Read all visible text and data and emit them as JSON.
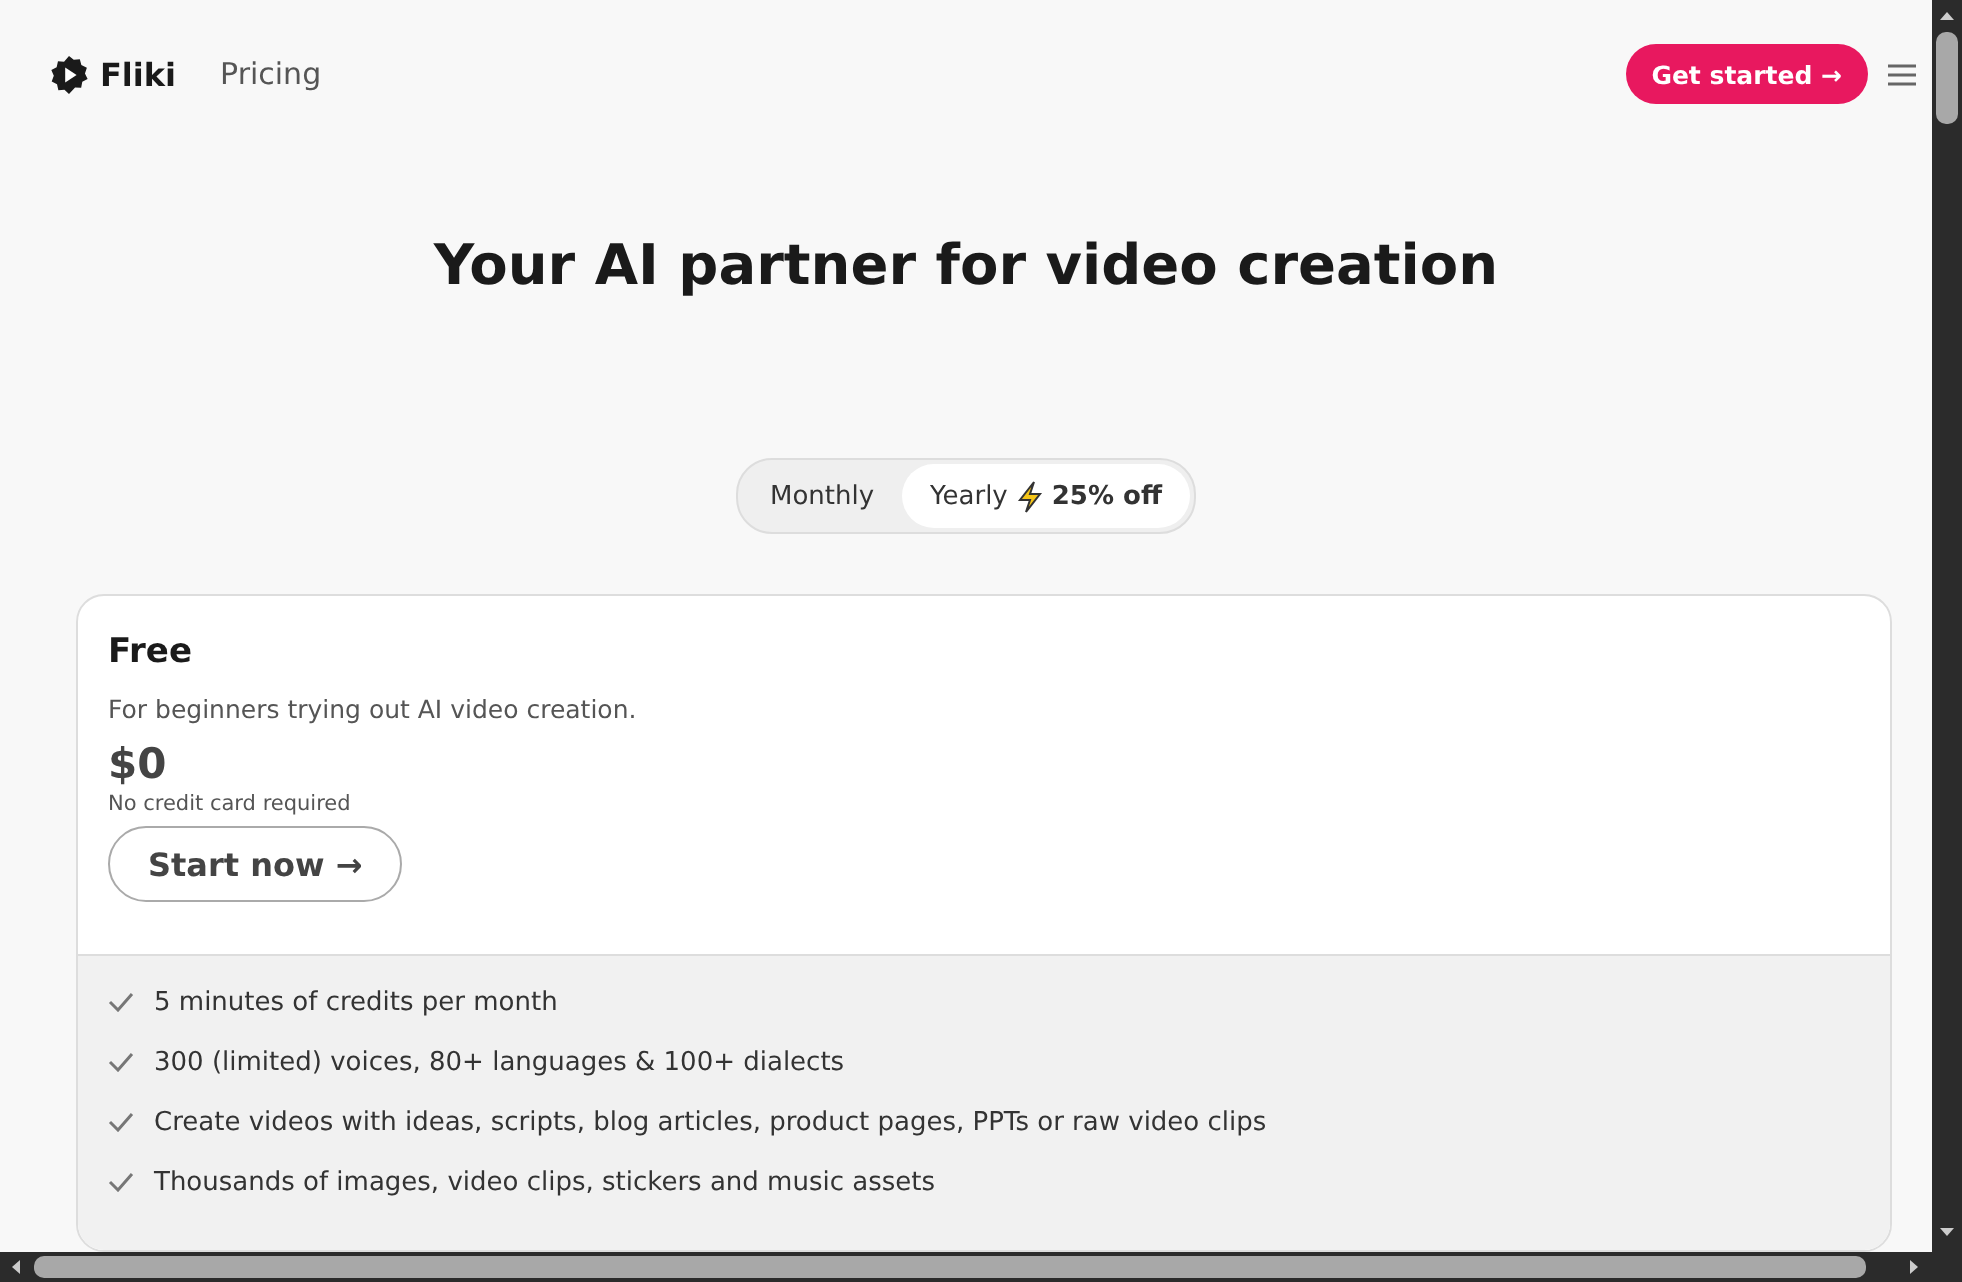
{
  "header": {
    "brand": "Fliki",
    "nav": [
      "Pricing"
    ],
    "cta": "Get started →"
  },
  "title": "Your AI partner for video creation",
  "billing_toggle": [
    {
      "label": "Monthly",
      "selected": false
    },
    {
      "label": "Yearly",
      "badge": "25% off",
      "selected": true
    }
  ],
  "plan": {
    "name": "Free",
    "description": "For beginners trying out AI video creation.",
    "price": "$0",
    "note": "No credit card required",
    "button": "Start now →",
    "features": [
      "5 minutes of credits per month",
      "300 (limited) voices, 80+ languages & 100+ dialects",
      "Create videos with ideas, scripts, blog articles, product pages, PPTs or raw video clips",
      "Thousands of images, video clips, stickers and music assets"
    ]
  }
}
